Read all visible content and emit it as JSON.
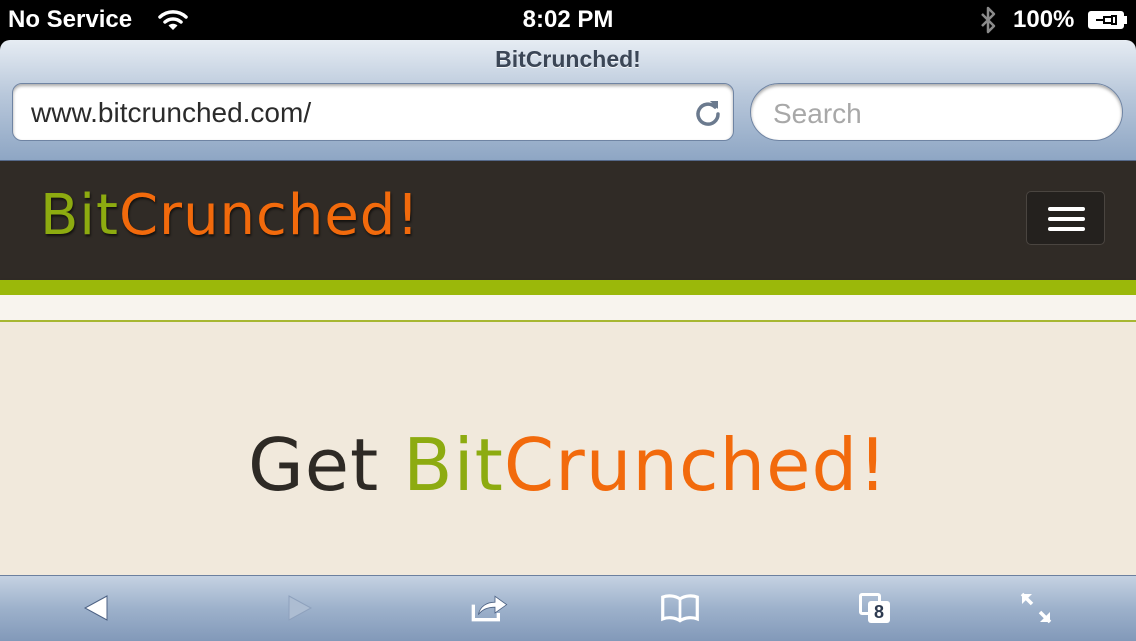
{
  "status_bar": {
    "carrier": "No Service",
    "time": "8:02 PM",
    "battery_percent": "100%"
  },
  "browser": {
    "page_title": "BitCrunched!",
    "url": "www.bitcrunched.com/",
    "search_placeholder": "Search",
    "tab_count": "8"
  },
  "site": {
    "logo_part1": "Bit",
    "logo_part2": "Crunched!",
    "hero_prefix": "Get",
    "hero_part1": "Bit",
    "hero_part2": "Crunched!",
    "colors": {
      "header_bg": "#302b26",
      "green": "#8dab10",
      "orange": "#f26a0c",
      "stripe": "#9bb80a",
      "content_bg": "#f1e9dc"
    }
  },
  "icons": {
    "status": [
      "wifi-icon",
      "bluetooth-icon",
      "battery-icon"
    ],
    "url_field": [
      "reload-icon"
    ],
    "header": [
      "menu-icon"
    ],
    "toolbar": [
      "back-icon",
      "forward-icon",
      "share-icon",
      "bookmarks-icon",
      "tabs-icon",
      "fullscreen-icon"
    ]
  }
}
